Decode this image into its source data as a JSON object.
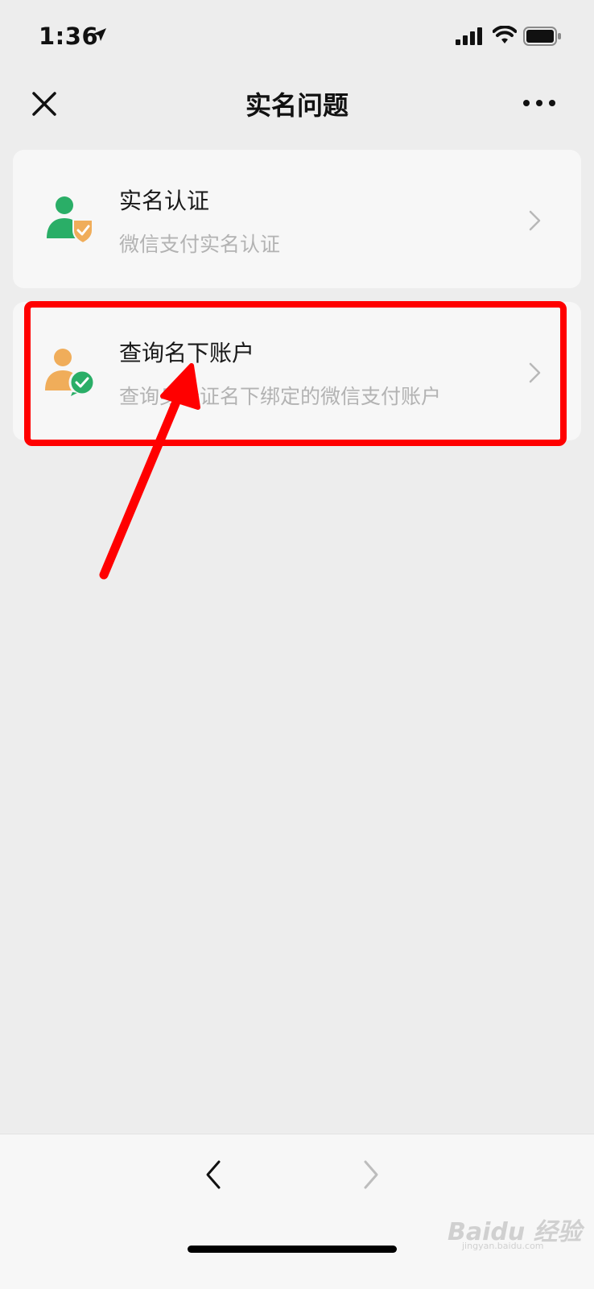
{
  "status_bar": {
    "time": "1:36"
  },
  "nav": {
    "title": "实名问题"
  },
  "cards": [
    {
      "title": "实名认证",
      "subtitle": "微信支付实名认证",
      "icon": "user-shield-icon"
    },
    {
      "title": "查询名下账户",
      "subtitle": "查询身份证名下绑定的微信支付账户",
      "icon": "user-check-icon"
    }
  ],
  "watermark": {
    "brand": "Baidu 经验",
    "url": "jingyan.baidu.com"
  },
  "colors": {
    "green": "#2aae67",
    "orange": "#f0ad5a",
    "annotation_red": "#ff0000"
  }
}
